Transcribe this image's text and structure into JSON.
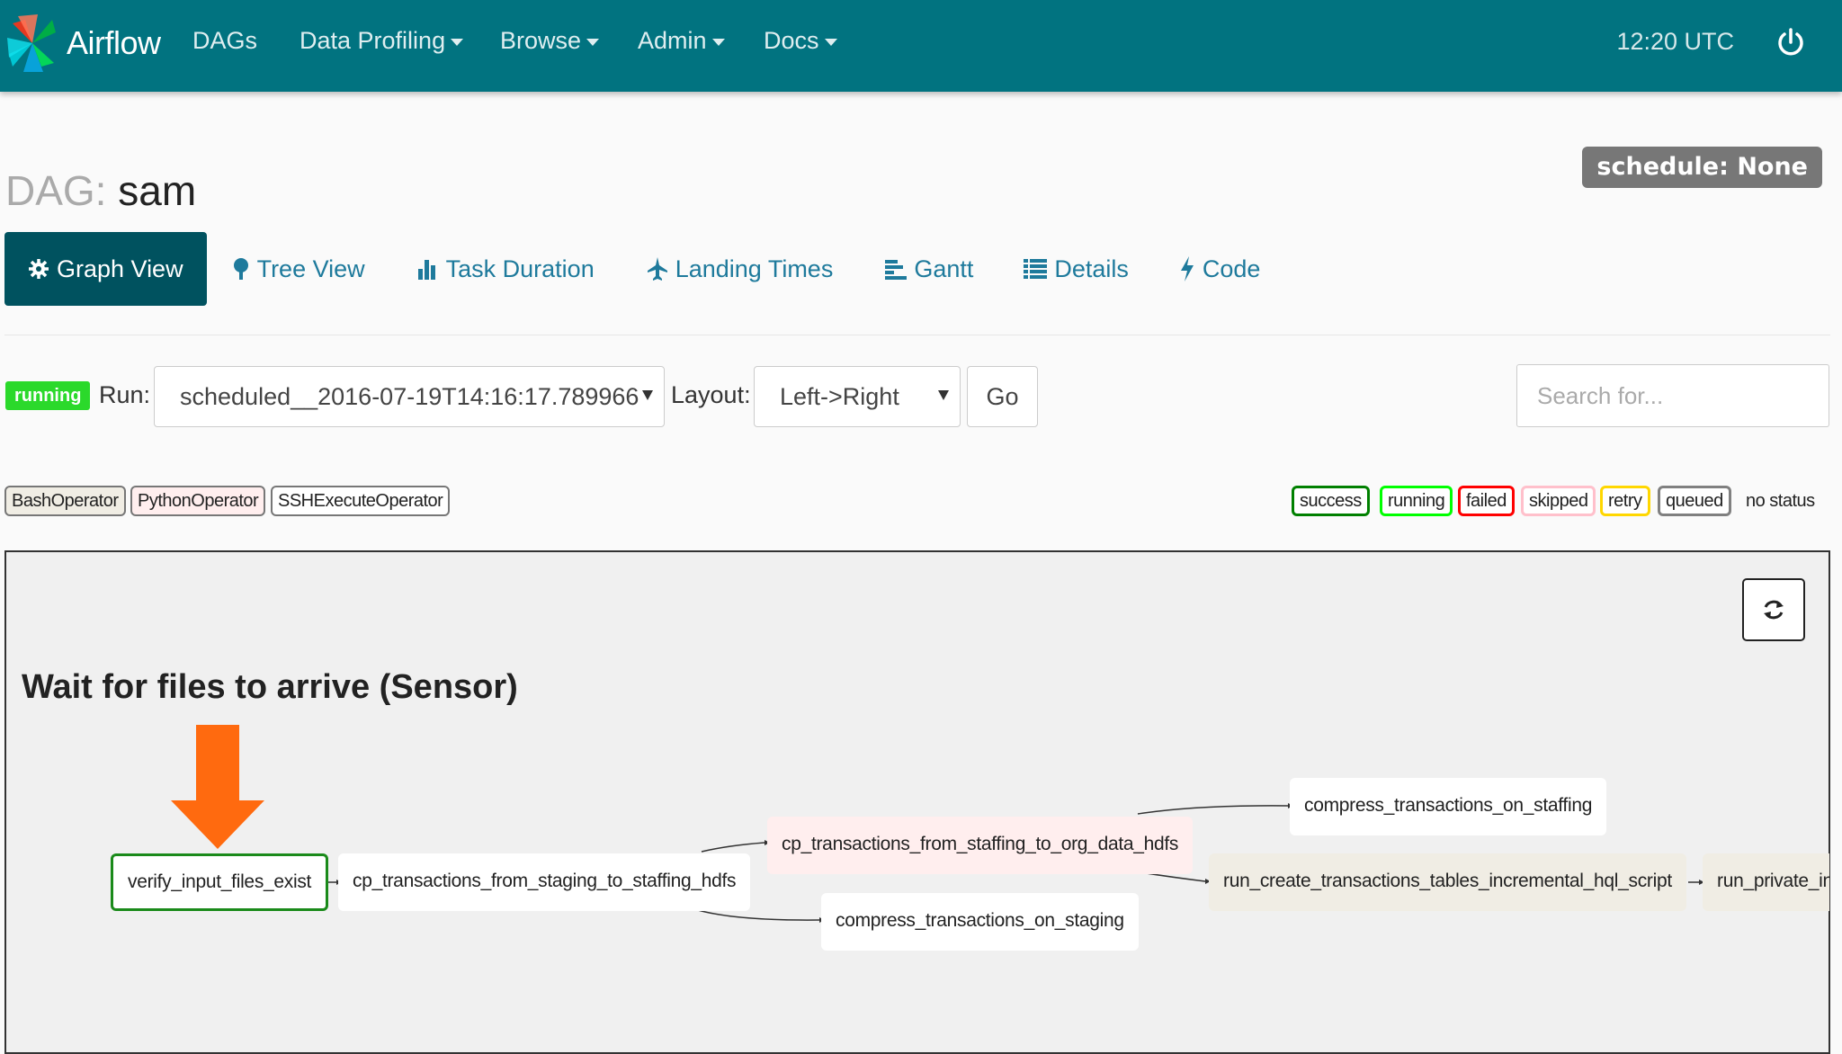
{
  "navbar": {
    "brand": "Airflow",
    "items": [
      {
        "label": "DAGs",
        "dropdown": false
      },
      {
        "label": "Data Profiling",
        "dropdown": true
      },
      {
        "label": "Browse",
        "dropdown": true
      },
      {
        "label": "Admin",
        "dropdown": true
      },
      {
        "label": "Docs",
        "dropdown": true
      }
    ],
    "time": "12:20 UTC",
    "bg_color": "#017380"
  },
  "header": {
    "dag_label": "DAG:",
    "dag_name": "sam",
    "schedule": "schedule: None"
  },
  "tabs": [
    {
      "label": "Graph View",
      "icon": "cog-icon",
      "active": true
    },
    {
      "label": "Tree View",
      "icon": "tree-icon",
      "active": false
    },
    {
      "label": "Task Duration",
      "icon": "bar-chart-icon",
      "active": false
    },
    {
      "label": "Landing Times",
      "icon": "plane-icon",
      "active": false
    },
    {
      "label": "Gantt",
      "icon": "gantt-icon",
      "active": false
    },
    {
      "label": "Details",
      "icon": "list-icon",
      "active": false
    },
    {
      "label": "Code",
      "icon": "flash-icon",
      "active": false
    }
  ],
  "run_controls": {
    "state": "running",
    "run_label": "Run:",
    "run_value": "scheduled__2016-07-19T14:16:17.789966",
    "layout_label": "Layout:",
    "layout_value": "Left->Right",
    "go_label": "Go",
    "search_placeholder": "Search for..."
  },
  "operators": [
    {
      "label": "BashOperator",
      "color": "#f0ede4"
    },
    {
      "label": "PythonOperator",
      "color": "#ffeeee"
    },
    {
      "label": "SSHExecuteOperator",
      "color": "#ffffff"
    }
  ],
  "legend": [
    {
      "label": "success",
      "color": "#008000"
    },
    {
      "label": "running",
      "color": "#00ff00"
    },
    {
      "label": "failed",
      "color": "#ff0000"
    },
    {
      "label": "skipped",
      "color": "#ffc0cb"
    },
    {
      "label": "retry",
      "color": "#ffd700"
    },
    {
      "label": "queued",
      "color": "#808080"
    },
    {
      "label": "no status",
      "color": "#fafafa"
    }
  ],
  "annotation": "Wait for files to arrive (Sensor)",
  "graph": {
    "nodes": [
      {
        "id": "verify_input_files_exist",
        "operator": "ssh",
        "state": "running"
      },
      {
        "id": "cp_transactions_from_staging_to_staffing_hdfs",
        "operator": "ssh"
      },
      {
        "id": "cp_transactions_from_staffing_to_org_data_hdfs",
        "operator": "python"
      },
      {
        "id": "compress_transactions_on_staffing",
        "operator": "ssh"
      },
      {
        "id": "compress_transactions_on_staging",
        "operator": "ssh"
      },
      {
        "id": "run_create_transactions_tables_incremental_hql_script",
        "operator": "bash"
      },
      {
        "id": "run_private_in",
        "operator": "bash"
      }
    ]
  }
}
